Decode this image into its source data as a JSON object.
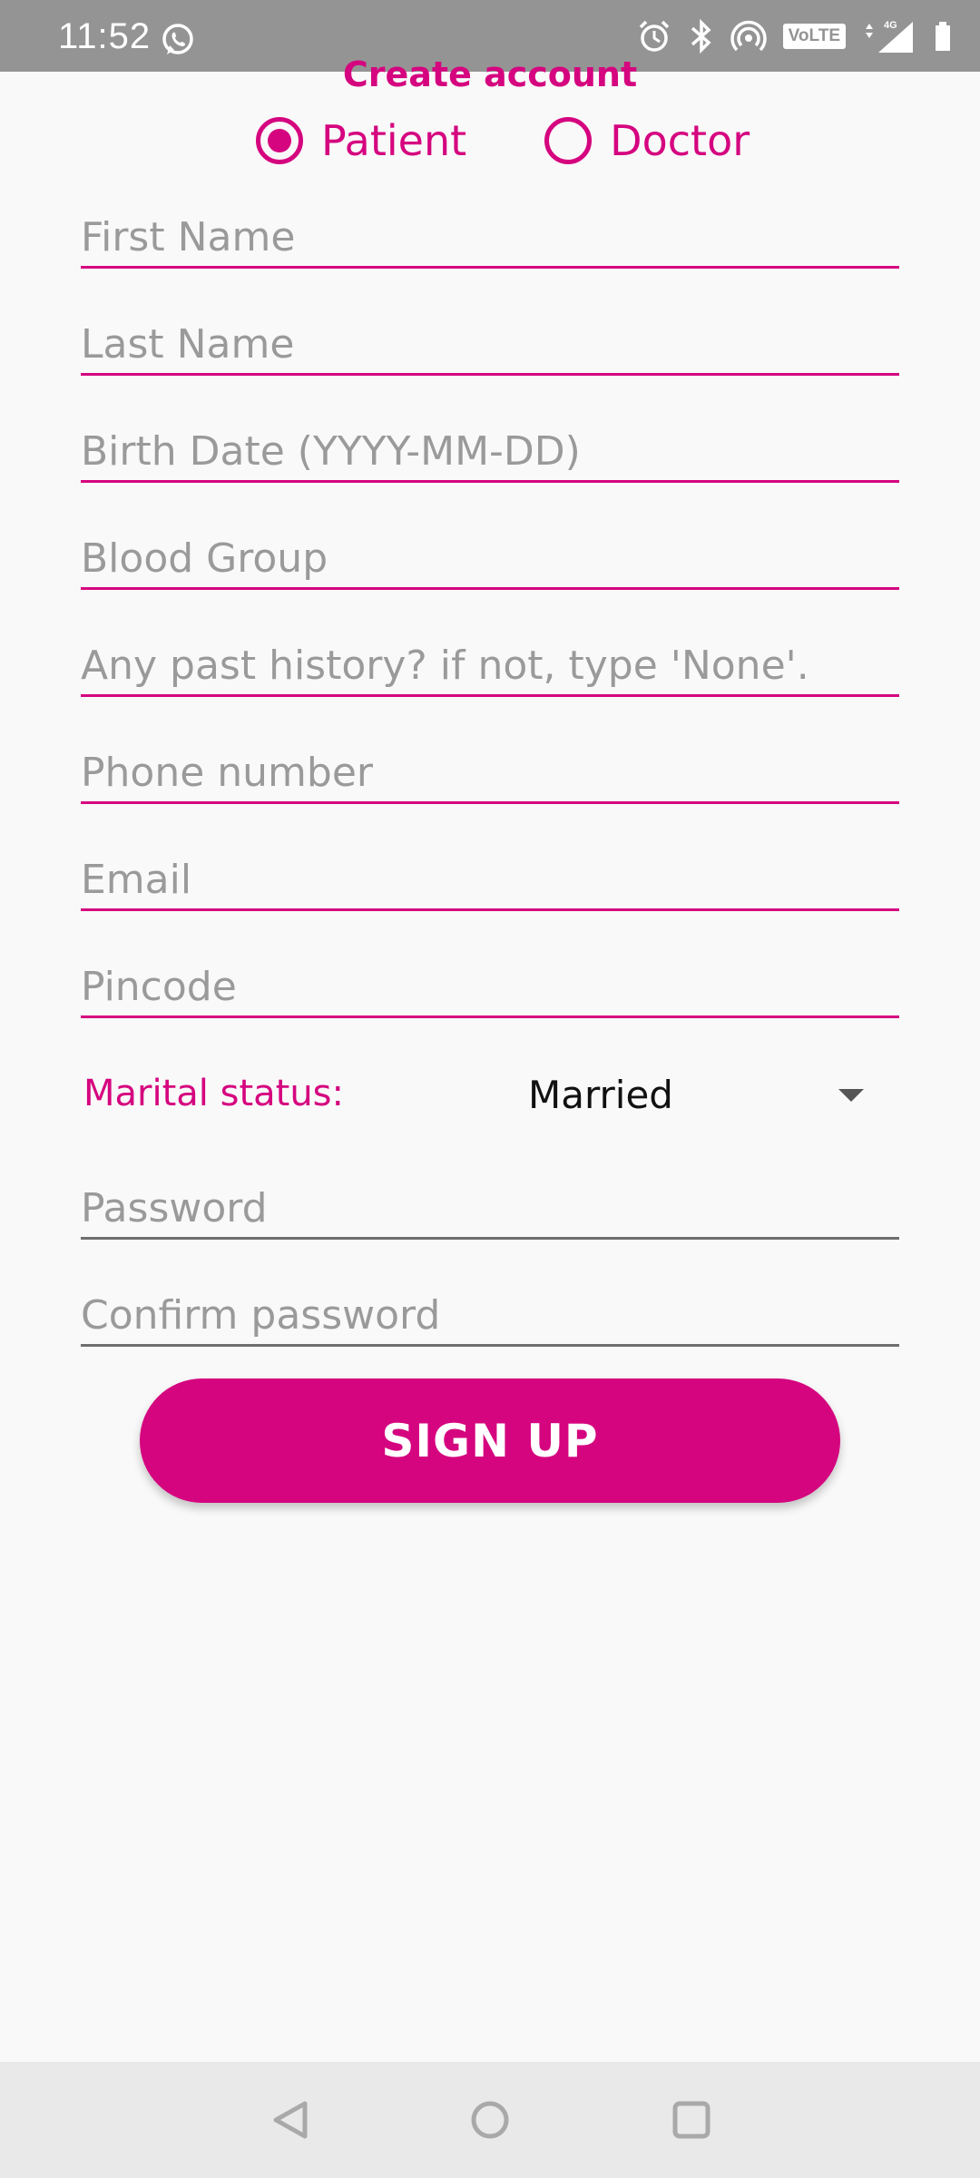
{
  "status_bar": {
    "time": "11:52",
    "network_badge": "VoLTE",
    "network_type": "4G",
    "icons": [
      "whatsapp-icon",
      "alarm-icon",
      "bluetooth-icon",
      "hotspot-icon",
      "volte-icon",
      "signal-icon",
      "battery-icon"
    ]
  },
  "form": {
    "title": "Create account",
    "roles": [
      {
        "label": "Patient",
        "selected": true
      },
      {
        "label": "Doctor",
        "selected": false
      }
    ],
    "fields": {
      "first_name": {
        "placeholder": "First Name",
        "value": ""
      },
      "last_name": {
        "placeholder": "Last Name",
        "value": ""
      },
      "birth_date": {
        "placeholder": "Birth Date (YYYY-MM-DD)",
        "value": ""
      },
      "blood_group": {
        "placeholder": "Blood Group",
        "value": ""
      },
      "past_history": {
        "placeholder": "Any past history? if not, type 'None'.",
        "value": ""
      },
      "phone": {
        "placeholder": "Phone number",
        "value": ""
      },
      "email": {
        "placeholder": "Email",
        "value": ""
      },
      "pincode": {
        "placeholder": "Pincode",
        "value": ""
      },
      "password": {
        "placeholder": "Password",
        "value": ""
      },
      "confirm_password": {
        "placeholder": "Confirm password",
        "value": ""
      }
    },
    "marital_status": {
      "label": "Marital status:",
      "selected": "Married"
    },
    "submit_label": "SIGN UP"
  },
  "colors": {
    "accent": "#d5047f",
    "status_bar": "#949494",
    "background": "#f9f9f9",
    "nav_bar": "#e9e9e9"
  },
  "nav_bar": {
    "buttons": [
      "back-icon",
      "home-icon",
      "recents-icon"
    ]
  }
}
